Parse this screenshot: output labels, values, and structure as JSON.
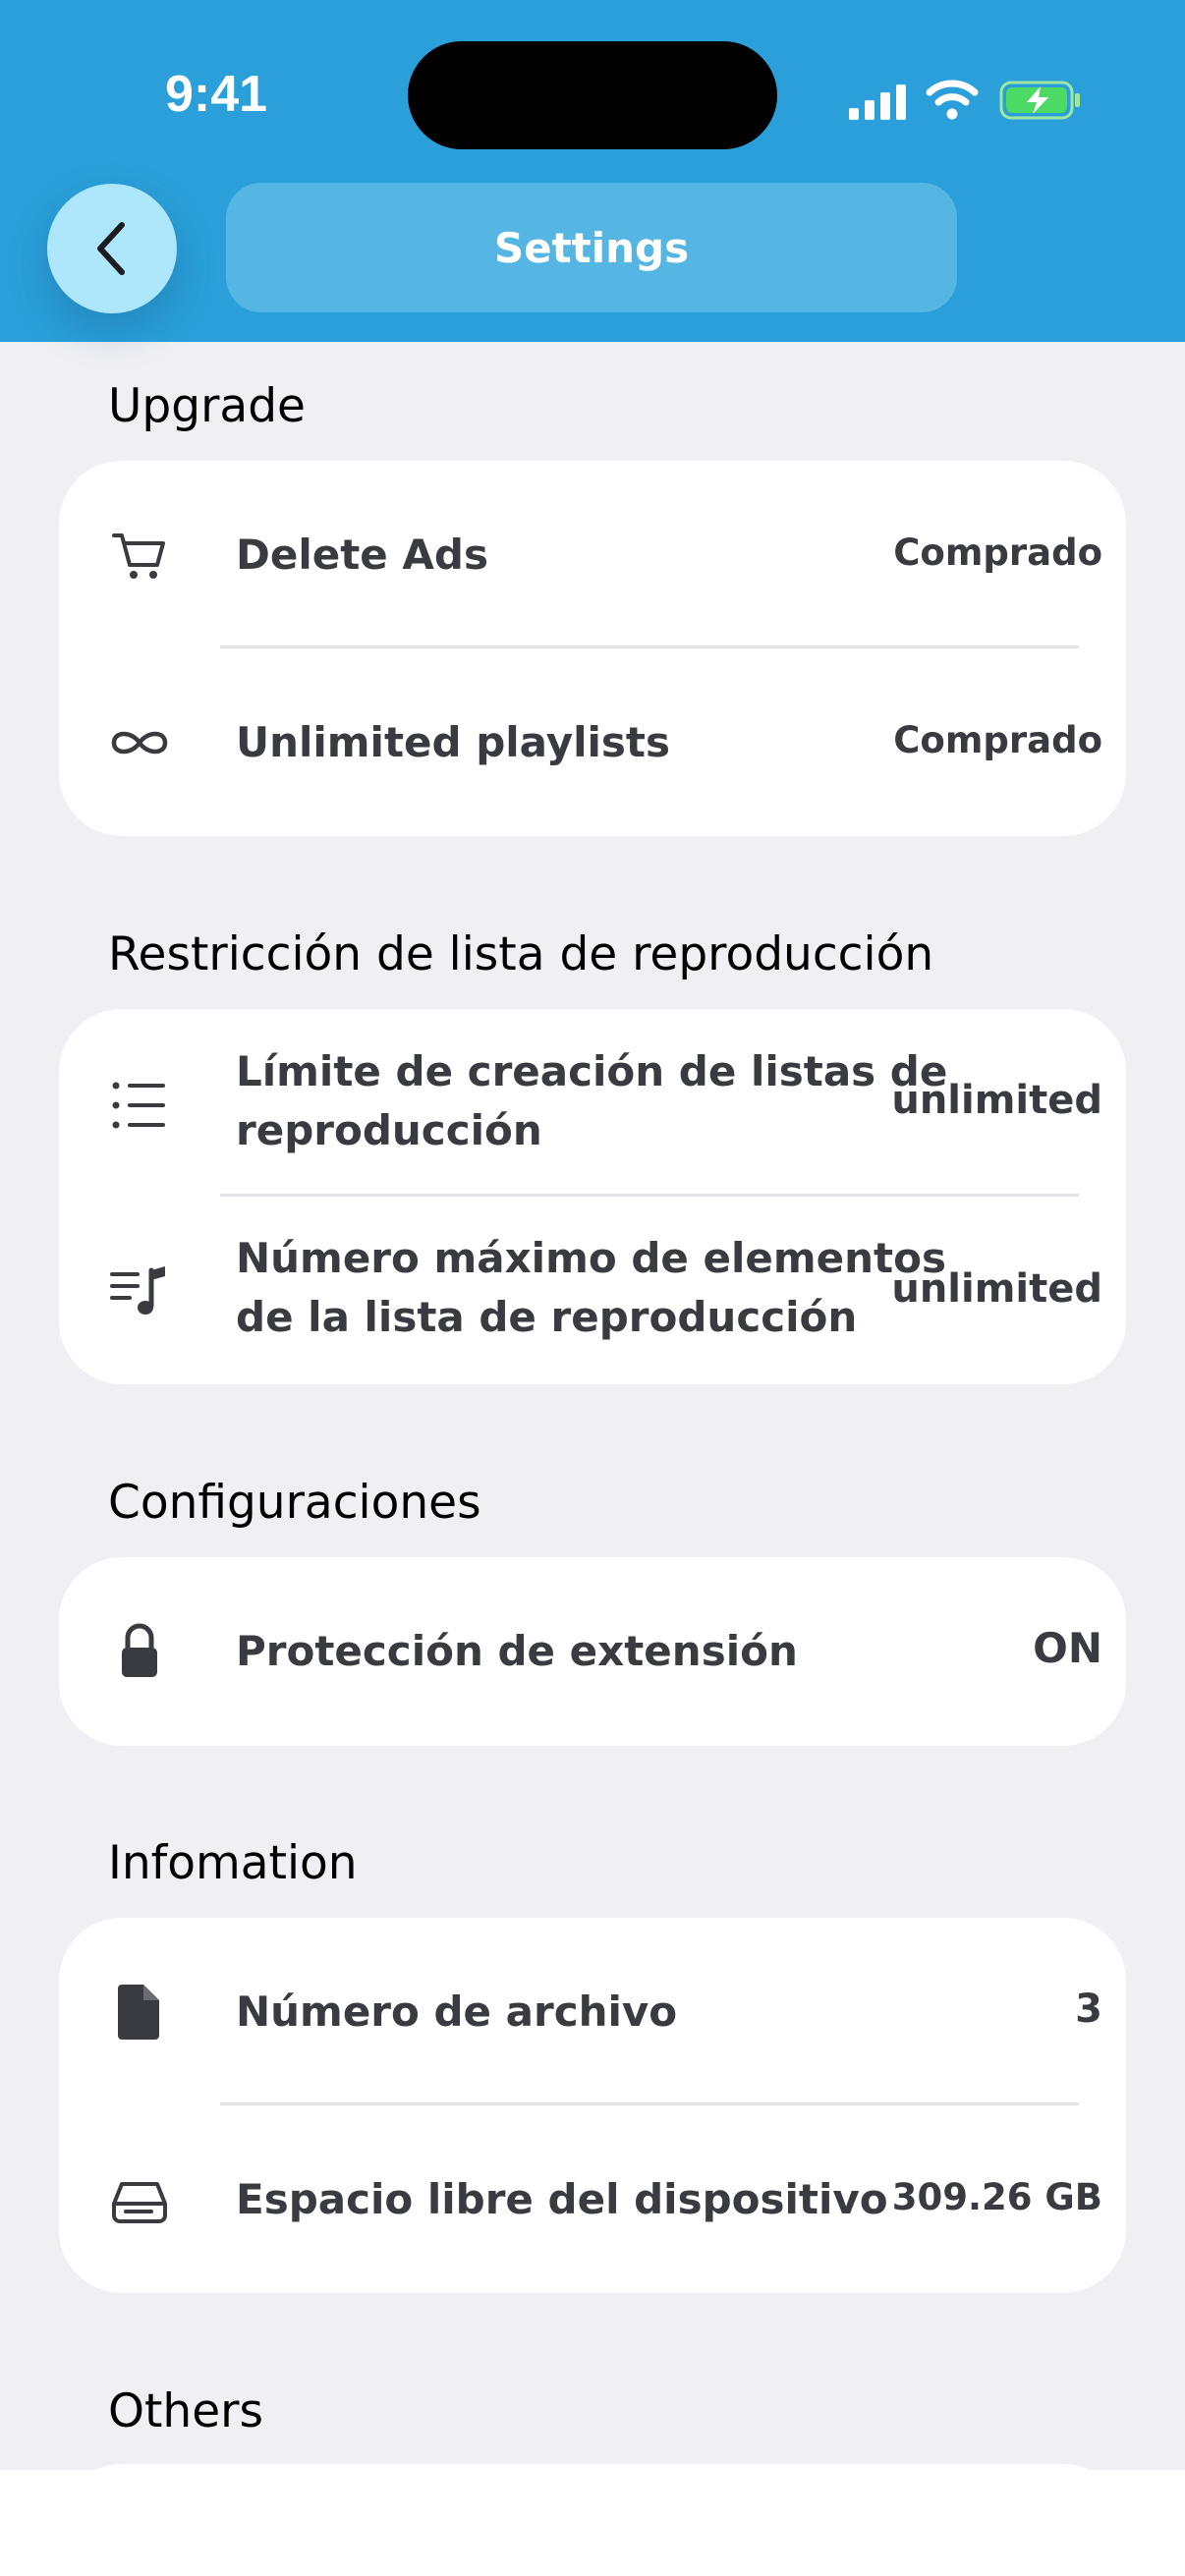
{
  "status_bar": {
    "time": "9:41"
  },
  "header": {
    "title": "Settings"
  },
  "sections": {
    "upgrade": {
      "title": "Upgrade",
      "rows": [
        {
          "icon": "cart-icon",
          "label": "Delete Ads",
          "value": "Comprado"
        },
        {
          "icon": "infinity-icon",
          "label": "Unlimited playlists",
          "value": "Comprado"
        }
      ]
    },
    "restriction": {
      "title": "Restricción de lista de reproducción",
      "rows": [
        {
          "icon": "list-icon",
          "label_line1": "Límite de creación de listas de",
          "label_line2": "reproducción",
          "value": "unlimited"
        },
        {
          "icon": "music-list-icon",
          "label_line1": "Número máximo de elementos",
          "label_line2": "de la lista de reproducción",
          "value": "unlimited"
        }
      ]
    },
    "config": {
      "title": "Configuraciones",
      "rows": [
        {
          "icon": "lock-icon",
          "label": "Protección de extensión",
          "value": "ON"
        }
      ]
    },
    "info": {
      "title": "Infomation",
      "rows": [
        {
          "icon": "file-icon",
          "label": "Número de archivo",
          "value": "3"
        },
        {
          "icon": "drive-icon",
          "label": "Espacio libre del dispositivo",
          "value": "309.26 GB"
        }
      ]
    },
    "others": {
      "title": "Others"
    }
  },
  "colors": {
    "header": "#2a9fd9",
    "background": "#f0f0f4",
    "back_button": "#aee6fb",
    "battery": "#4cd964"
  }
}
